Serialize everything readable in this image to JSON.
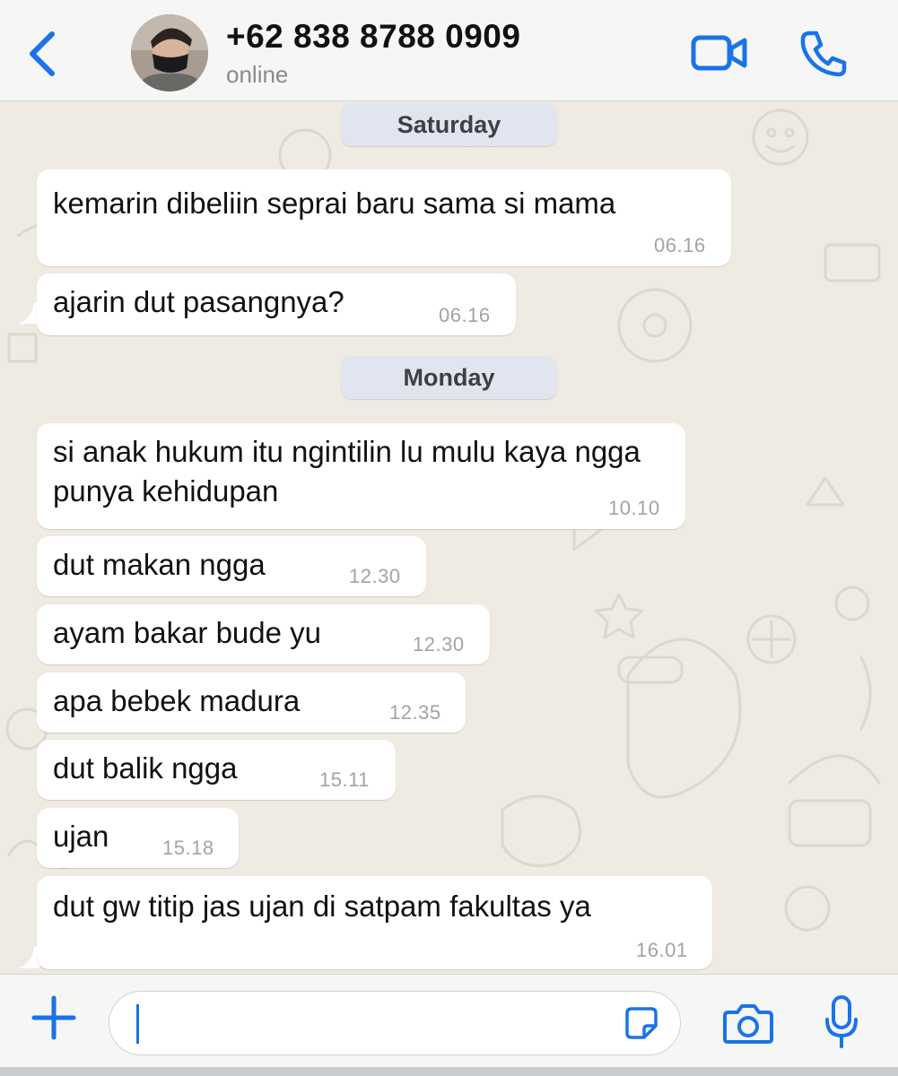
{
  "header": {
    "contact_name": "+62 838 8788 0909",
    "status": "online",
    "icons": {
      "back": "chevron-left-icon",
      "video": "video-camera-icon",
      "call": "phone-icon"
    },
    "accent_color": "#1a73e8"
  },
  "chat": {
    "date_separators": [
      "Saturday",
      "Monday"
    ],
    "messages": [
      {
        "text": "kemarin dibeliin seprai baru sama si mama",
        "time": "06.16"
      },
      {
        "text": "ajarin dut pasangnya?",
        "time": "06.16"
      },
      {
        "text": "si anak hukum itu ngintilin lu mulu kaya ngga punya kehidupan",
        "time": "10.10"
      },
      {
        "text": "dut makan ngga",
        "time": "12.30"
      },
      {
        "text": "ayam bakar bude yu",
        "time": "12.30"
      },
      {
        "text": "apa bebek madura",
        "time": "12.35"
      },
      {
        "text": "dut balik ngga",
        "time": "15.11"
      },
      {
        "text": "ujan",
        "time": "15.18"
      },
      {
        "text": "dut gw titip jas ujan di satpam fakultas ya",
        "time": "16.01"
      }
    ]
  },
  "input_bar": {
    "value": "",
    "icons": {
      "add": "plus-icon",
      "sticker": "sticker-icon",
      "camera": "camera-icon",
      "mic": "microphone-icon"
    }
  }
}
